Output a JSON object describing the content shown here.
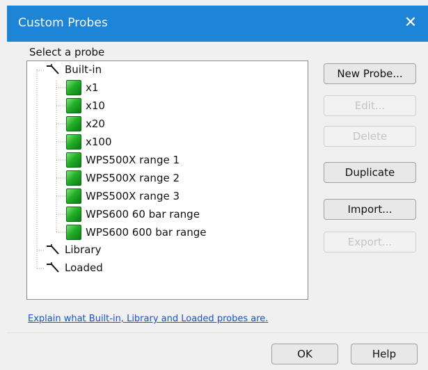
{
  "window": {
    "title": "Custom Probes",
    "close_label": "✕"
  },
  "tree": {
    "label": "Select a probe",
    "groups": [
      {
        "name": "Built-in",
        "items": [
          "x1",
          "x10",
          "x20",
          "x100",
          "WPS500X range 1",
          "WPS500X range 2",
          "WPS500X range 3",
          "WPS600 60 bar range",
          "WPS600 600 bar range"
        ]
      },
      {
        "name": "Library",
        "items": []
      },
      {
        "name": "Loaded",
        "items": []
      }
    ]
  },
  "buttons": {
    "new_probe": "New Probe...",
    "edit": "Edit...",
    "delete": "Delete",
    "duplicate": "Duplicate",
    "import": "Import...",
    "export": "Export...",
    "ok": "OK",
    "help": "Help"
  },
  "links": {
    "explain": "Explain what Built-in, Library and Loaded probes are."
  },
  "colors": {
    "titlebar": "#1e84d6",
    "probe_icon": "#22b027",
    "link": "#1a4fd6"
  },
  "icons": {
    "folder": "probe-folder-icon",
    "probe": "probe-icon"
  }
}
